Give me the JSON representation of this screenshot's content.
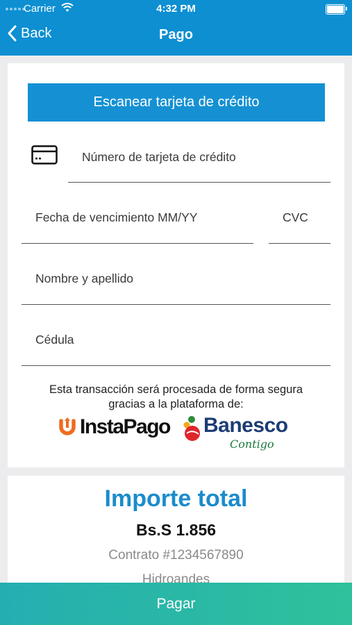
{
  "status_bar": {
    "carrier": "Carrier",
    "time": "4:32 PM"
  },
  "nav": {
    "back_label": "Back",
    "title": "Pago"
  },
  "payment": {
    "scan_button": "Escanear tarjeta de crédito",
    "card_number_placeholder": "Número de tarjeta de crédito",
    "expiry_placeholder": "Fecha de vencimiento MM/YY",
    "cvc_placeholder": "CVC",
    "name_placeholder": "Nombre y apellido",
    "cedula_placeholder": "Cédula",
    "secure_line1": "Esta transacción será procesada de forma segura",
    "secure_line2": "gracias a la plataforma de:",
    "logos": {
      "instapago": "InstaPago",
      "banesco": "Banesco",
      "banesco_tagline": "Contigo"
    }
  },
  "summary": {
    "title": "Importe total",
    "amount": "Bs.S 1.856",
    "contract": "Contrato #1234567890",
    "company": "Hidroandes"
  },
  "pay_button": "Pagar",
  "colors": {
    "nav": "#0d8fd2",
    "accent": "#1591d3",
    "pay_gradient_start": "#25aeb1",
    "pay_gradient_end": "#2fc19b"
  }
}
